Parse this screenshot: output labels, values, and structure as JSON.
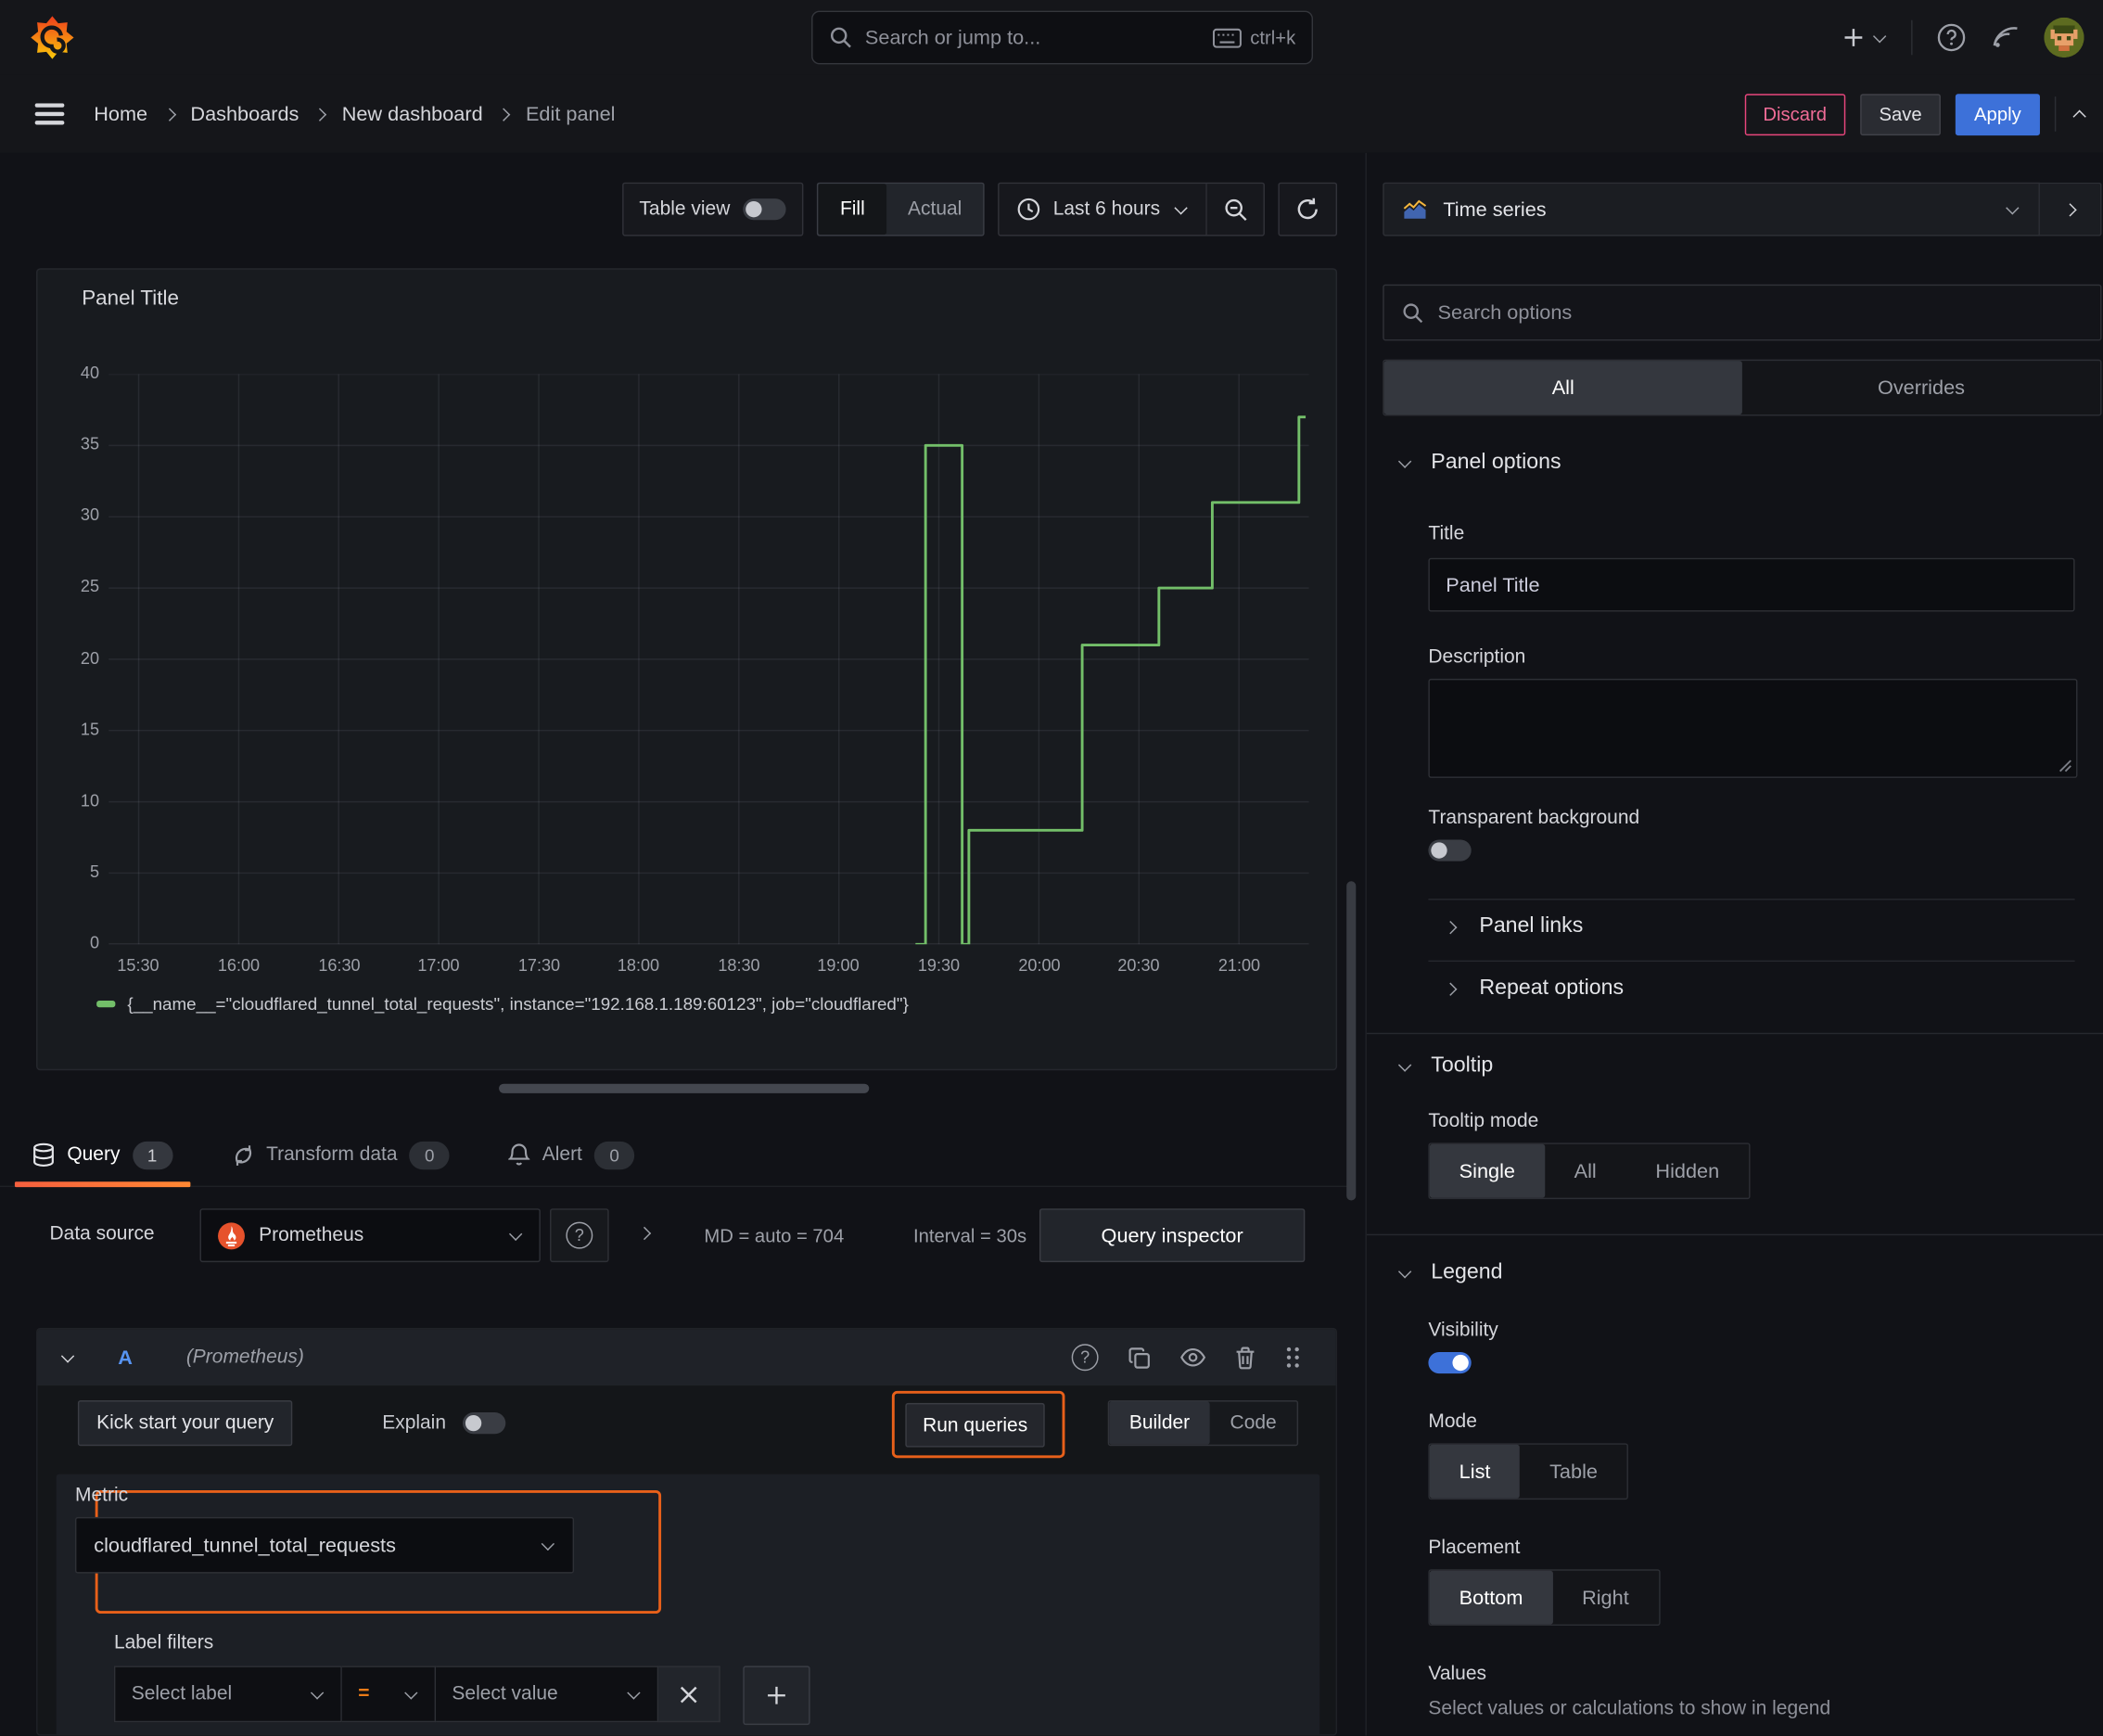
{
  "topbar": {
    "search_placeholder": "Search or jump to...",
    "shortcut": "ctrl+k"
  },
  "breadcrumb": {
    "items": [
      "Home",
      "Dashboards",
      "New dashboard",
      "Edit panel"
    ],
    "discard": "Discard",
    "save": "Save",
    "apply": "Apply"
  },
  "toolbar": {
    "table_view": "Table view",
    "fill": "Fill",
    "actual": "Actual",
    "time_range": "Last 6 hours"
  },
  "panel": {
    "title": "Panel Title"
  },
  "chart_data": {
    "type": "line",
    "title": "Panel Title",
    "line_color": "#73bf69",
    "grid": true,
    "legend_position": "bottom",
    "x_start": "15:21",
    "x_end": "21:21",
    "xticks": [
      "15:30",
      "16:00",
      "16:30",
      "17:00",
      "17:30",
      "18:00",
      "18:30",
      "19:00",
      "19:30",
      "20:00",
      "20:30",
      "21:00"
    ],
    "yticks": [
      0,
      5,
      10,
      15,
      20,
      25,
      30,
      35,
      40
    ],
    "ylim": [
      0,
      40
    ],
    "series": [
      {
        "name": "{__name__=\"cloudflared_tunnel_total_requests\", instance=\"192.168.1.189:60123\", job=\"cloudflared\"}",
        "points": [
          [
            "19:23",
            0
          ],
          [
            "19:26",
            0
          ],
          [
            "19:26",
            35
          ],
          [
            "19:37",
            35
          ],
          [
            "19:37",
            0
          ],
          [
            "19:39",
            0
          ],
          [
            "19:39",
            8
          ],
          [
            "20:13",
            8
          ],
          [
            "20:13",
            21
          ],
          [
            "20:36",
            21
          ],
          [
            "20:36",
            25
          ],
          [
            "20:52",
            25
          ],
          [
            "20:52",
            31
          ],
          [
            "21:18",
            31
          ],
          [
            "21:18",
            37
          ],
          [
            "21:20",
            37
          ]
        ]
      }
    ]
  },
  "tabs": {
    "query": "Query",
    "query_count": "1",
    "transform": "Transform data",
    "transform_count": "0",
    "alert": "Alert",
    "alert_count": "0"
  },
  "datasource": {
    "label": "Data source",
    "name": "Prometheus",
    "md": "MD = auto = 704",
    "interval": "Interval = 30s",
    "inspector": "Query inspector",
    "help_glyph": "?"
  },
  "query_editor": {
    "ref_id": "A",
    "ds_hint": "(Prometheus)",
    "kickstart": "Kick start your query",
    "explain": "Explain",
    "run": "Run queries",
    "builder": "Builder",
    "code": "Code",
    "metric_label": "Metric",
    "metric_value": "cloudflared_tunnel_total_requests",
    "label_filters": "Label filters",
    "select_label": "Select label",
    "operator": "=",
    "select_value": "Select value"
  },
  "sidebar": {
    "viz_type": "Time series",
    "search_placeholder": "Search options",
    "tab_all": "All",
    "tab_overrides": "Overrides",
    "panel_options": {
      "title": "Panel options",
      "title_label": "Title",
      "title_value": "Panel Title",
      "description_label": "Description",
      "transparent_label": "Transparent background"
    },
    "panel_links": "Panel links",
    "repeat_options": "Repeat options",
    "tooltip": {
      "title": "Tooltip",
      "mode_label": "Tooltip mode",
      "options": [
        "Single",
        "All",
        "Hidden"
      ]
    },
    "legend": {
      "title": "Legend",
      "visibility_label": "Visibility",
      "mode_label": "Mode",
      "mode_options": [
        "List",
        "Table"
      ],
      "placement_label": "Placement",
      "placement_options": [
        "Bottom",
        "Right"
      ],
      "values_label": "Values",
      "values_help": "Select values or calculations to show in legend"
    }
  },
  "colors": {
    "accent_blue": "#3d71d9",
    "annotation_orange": "#e8601a",
    "series_green": "#73bf69",
    "discard_pink": "#e8467c"
  }
}
